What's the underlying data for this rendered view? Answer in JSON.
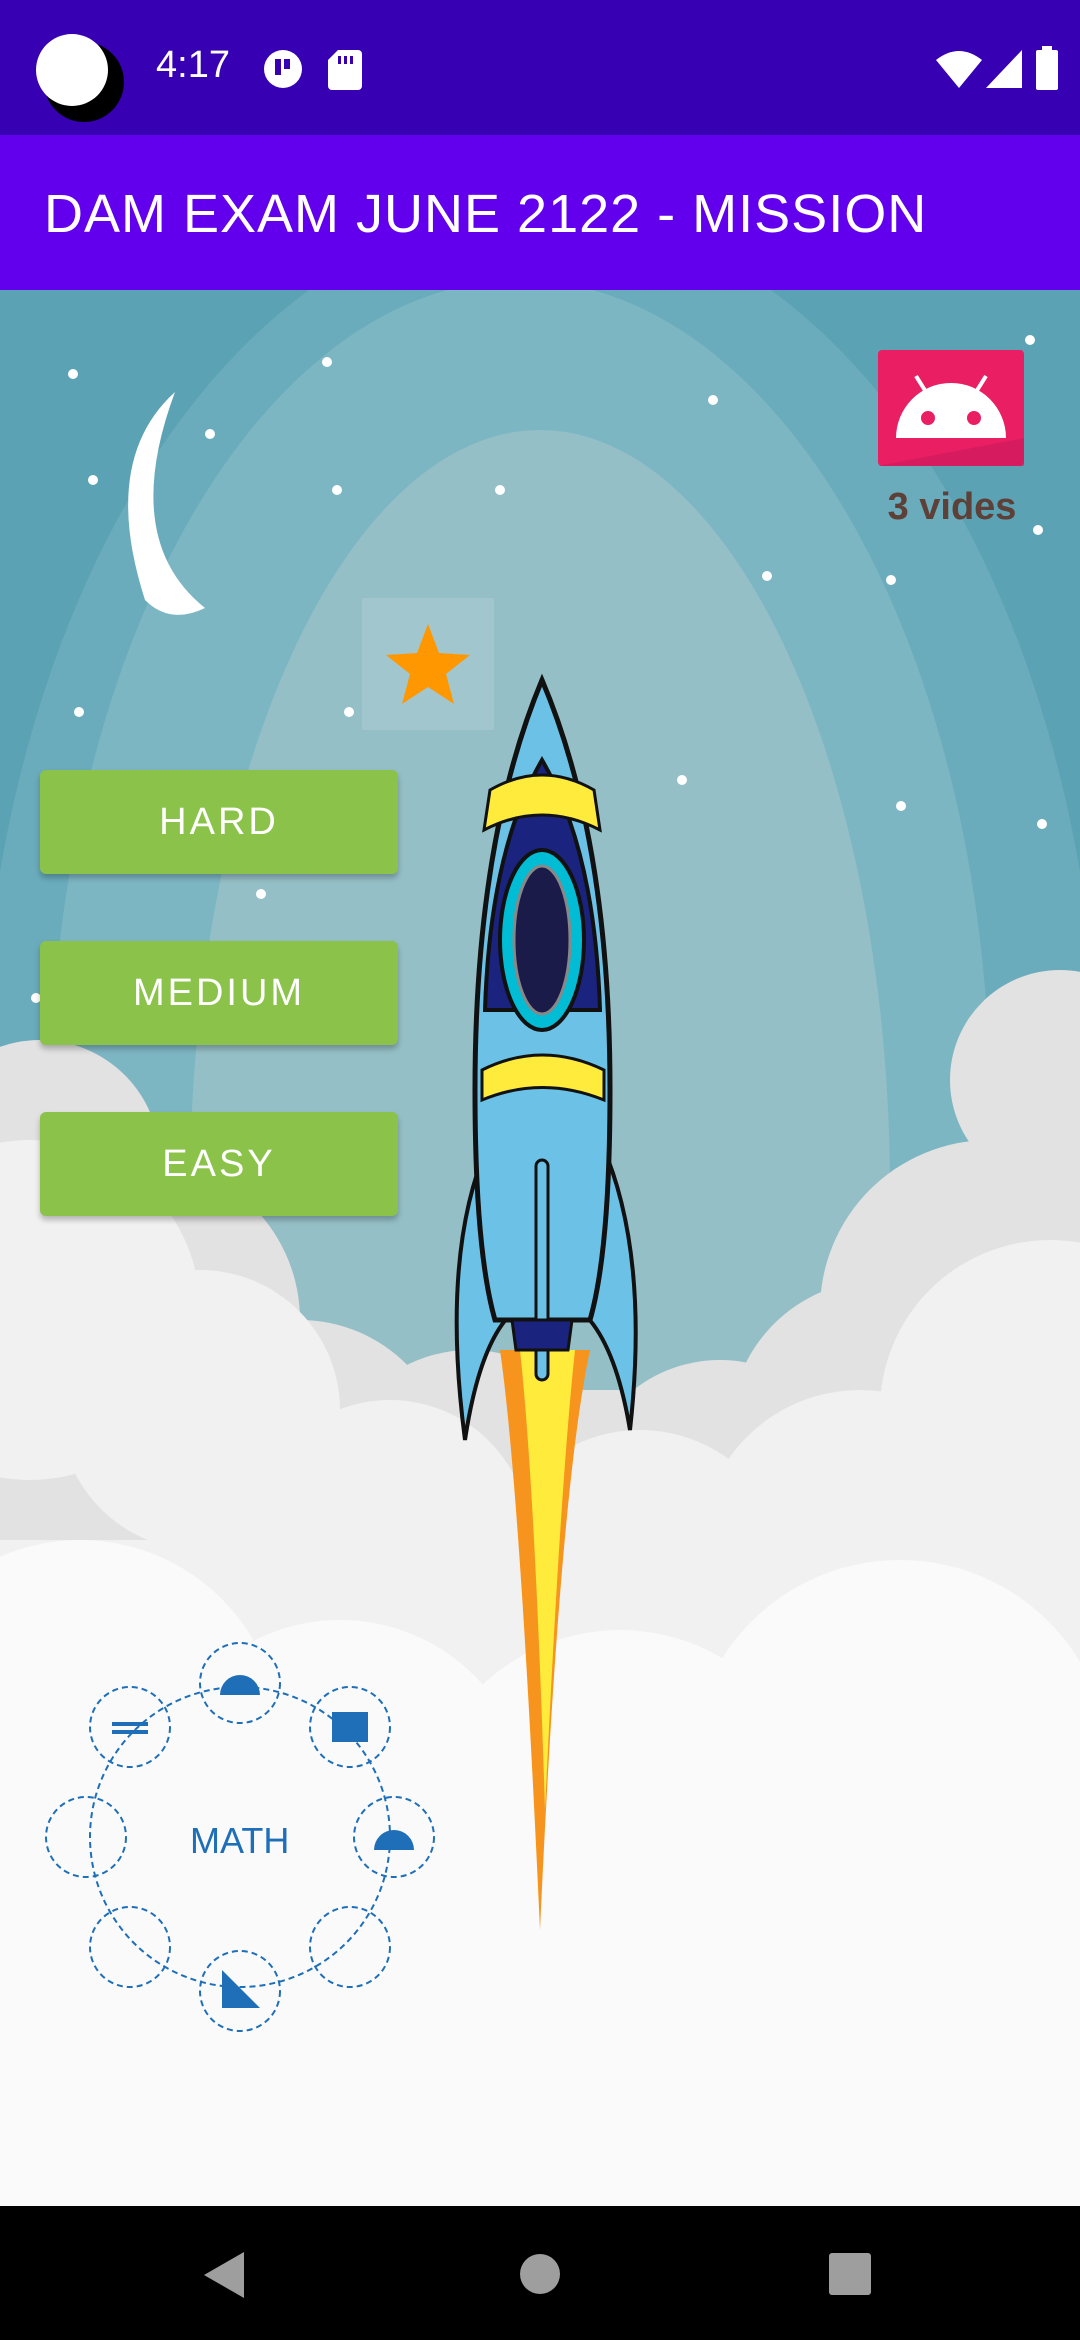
{
  "status_bar": {
    "time": "4:17"
  },
  "app_bar": {
    "title": "DAM EXAM JUNE 2122 - MISSION"
  },
  "difficulty": {
    "hard": "HARD",
    "medium": "MEDIUM",
    "easy": "EASY"
  },
  "lives": {
    "label": "3 vides"
  },
  "math_badge": {
    "label": "MATH"
  },
  "colors": {
    "status_bar": "#3700b3",
    "app_bar": "#6200ee",
    "button": "#8bc34a",
    "lives_icon": "#e91e63",
    "sky": "#5aa2b4"
  },
  "icons": [
    "circle-icon",
    "data-saver-icon",
    "sd-card-icon",
    "wifi-icon",
    "signal-icon",
    "battery-icon",
    "android-icon",
    "star-icon",
    "back-icon",
    "home-icon",
    "recents-icon"
  ]
}
